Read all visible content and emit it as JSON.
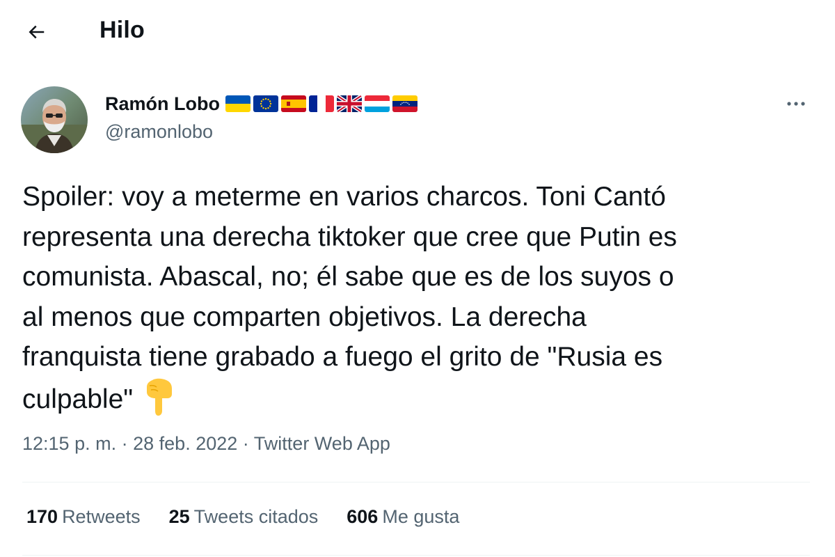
{
  "header": {
    "title": "Hilo"
  },
  "tweet": {
    "author": {
      "name": "Ramón Lobo",
      "handle": "@ramonlobo",
      "flags": [
        "ukraine-flag",
        "eu-flag",
        "spain-flag",
        "france-flag",
        "uk-flag",
        "luxembourg-flag",
        "venezuela-flag"
      ]
    },
    "text_lines": [
      "Spoiler: voy a meterme en varios charcos. Toni Cantó",
      "representa una derecha tiktoker que cree que Putin es",
      "comunista. Abascal, no; él sabe que es de los suyos o",
      "al menos que comparten objetivos. La derecha",
      "franquista tiene grabado a fuego el grito de \"Rusia es",
      "culpable\""
    ],
    "emoji": "backhand-index-pointing-down",
    "time": "12:15 p. m.",
    "separator": "·",
    "date": "28 feb. 2022",
    "source": "Twitter Web App"
  },
  "stats": {
    "retweets": {
      "count": "170",
      "label": "Retweets"
    },
    "quotes": {
      "count": "25",
      "label": "Tweets citados"
    },
    "likes": {
      "count": "606",
      "label": "Me gusta"
    }
  },
  "colors": {
    "text": "#0f1419",
    "secondary": "#536471",
    "divider": "#eff3f4"
  }
}
